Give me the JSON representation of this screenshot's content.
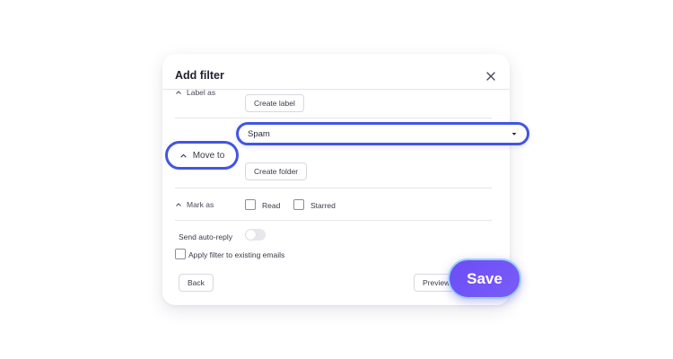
{
  "modal": {
    "title": "Add filter"
  },
  "label_section": {
    "label": "Label as",
    "create_button": "Create label"
  },
  "move_section": {
    "label": "Move to",
    "selected_folder": "Spam",
    "create_button": "Create folder"
  },
  "mark_section": {
    "label": "Mark as",
    "options": [
      "Read",
      "Starred"
    ]
  },
  "auto_reply": {
    "label": "Send auto-reply",
    "enabled": false
  },
  "apply_existing": {
    "label": "Apply filter to existing emails"
  },
  "footer": {
    "back_label": "Back",
    "preview_label": "Preview",
    "save_label": "Save"
  },
  "colors": {
    "highlight": "#4255e3",
    "save_bg": "#6b4ef6"
  },
  "icons": [
    "close-icon",
    "chevron-up-icon",
    "caret-down-icon"
  ]
}
